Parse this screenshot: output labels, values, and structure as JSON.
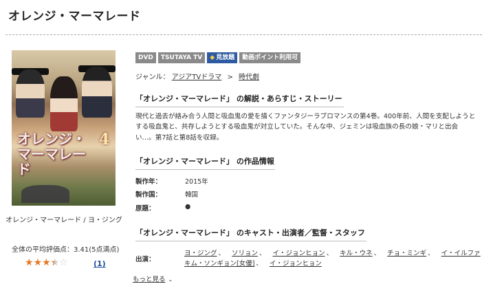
{
  "page": {
    "title": "オレンジ・マーマレード"
  },
  "cover": {
    "alt": "オレンジ・マーマレード 4",
    "logo_text": "オレンジ・マーマレード",
    "logo_number": "4"
  },
  "left": {
    "caption": "オレンジ・マーマレード / ヨ・ジング",
    "rating_text": "全体の平均評価点：3.41(5点満点)",
    "rating_value": 3.41,
    "rating_max": 5,
    "review_count_label": "(1)"
  },
  "tags": [
    {
      "label": "DVD",
      "color": "#8a8a8a"
    },
    {
      "label": "TSUTAYA TV",
      "color": "#8a8a8a"
    },
    {
      "label": "見放題",
      "color": "#2d5aa0"
    },
    {
      "label": "動画ポイント利用可",
      "color": "#8a8a8a"
    }
  ],
  "genre": {
    "label": "ジャンル：",
    "items": [
      "アジアTVドラマ",
      "時代劇"
    ],
    "separator": ">"
  },
  "sections": {
    "story_heading": "「オレンジ・マーマレード」 の解説・あらすじ・ストーリー",
    "story_text": "現代と過去が絡み合う人間と吸血鬼の愛を描くファンタジーラブロマンスの第4巻。400年前、人間を支配しようとする吸血鬼と、共存しようとする吸血鬼が対立していた。そんな中、ジェミンは吸血族の長の娘・マリと出会い…。第7話と第8話を収録。",
    "info_heading": "「オレンジ・マーマレード」 の作品情報",
    "cast_heading": "「オレンジ・マーマレード」 のキャスト・出演者／監督・スタッフ"
  },
  "info": [
    {
      "label": "製作年：",
      "value": "2015年"
    },
    {
      "label": "製作国：",
      "value": "韓国"
    },
    {
      "label": "原題：",
      "value": "●"
    }
  ],
  "cast": {
    "label": "出演：",
    "line1": [
      "ヨ・ジング",
      "ソリョン",
      "イ・ジョンヒョン",
      "キル・ウネ",
      "チョ・ミンギ",
      "イ・イルファ"
    ],
    "line2": [
      "キム・ソンギョン[女優]",
      "イ・ジョンヒョン"
    ],
    "comma": "、"
  },
  "more": {
    "label": "もっと見る",
    "icon": "chevron-down-icon"
  }
}
